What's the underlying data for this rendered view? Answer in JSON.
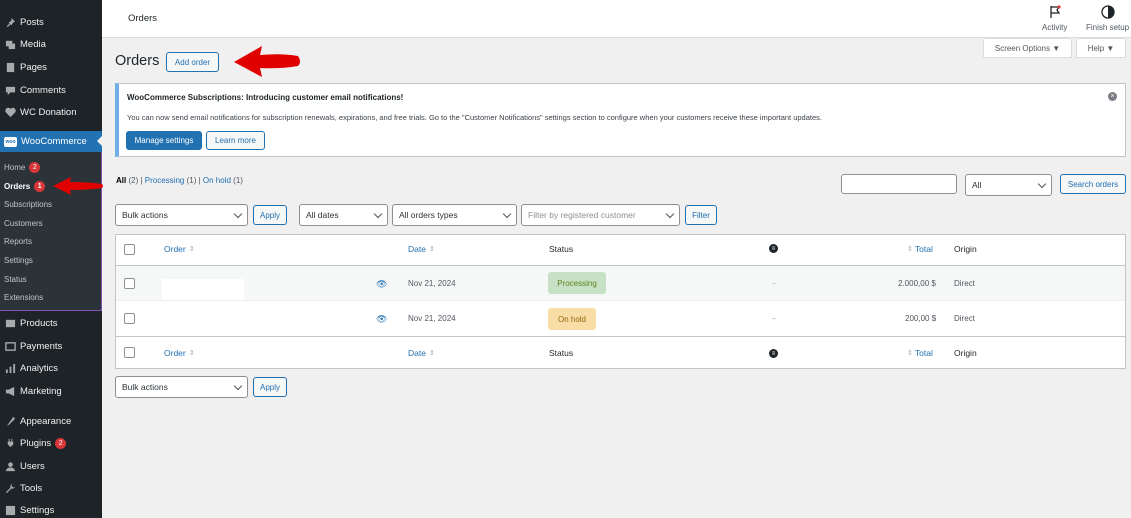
{
  "sidebar": {
    "items": [
      {
        "label": "Posts",
        "icon": "pin-icon"
      },
      {
        "label": "Media",
        "icon": "media-icon"
      },
      {
        "label": "Pages",
        "icon": "pages-icon"
      },
      {
        "label": "Comments",
        "icon": "comments-icon"
      },
      {
        "label": "WC Donation",
        "icon": "heart-icon"
      }
    ],
    "woocommerce": {
      "label": "WooCommerce",
      "logo_text": "woo",
      "submenu": [
        {
          "label": "Home",
          "badge": "2"
        },
        {
          "label": "Orders",
          "badge": "1"
        },
        {
          "label": "Subscriptions"
        },
        {
          "label": "Customers"
        },
        {
          "label": "Reports"
        },
        {
          "label": "Settings"
        },
        {
          "label": "Status"
        },
        {
          "label": "Extensions"
        }
      ]
    },
    "lower_items": [
      {
        "label": "Products",
        "icon": "products-icon"
      },
      {
        "label": "Payments",
        "icon": "payments-icon"
      },
      {
        "label": "Analytics",
        "icon": "analytics-icon"
      },
      {
        "label": "Marketing",
        "icon": "marketing-icon"
      },
      {
        "label": "Appearance",
        "icon": "appearance-icon"
      },
      {
        "label": "Plugins",
        "icon": "plugins-icon",
        "badge": "2"
      },
      {
        "label": "Users",
        "icon": "users-icon"
      },
      {
        "label": "Tools",
        "icon": "tools-icon"
      },
      {
        "label": "Settings",
        "icon": "settings-icon"
      }
    ]
  },
  "topbar": {
    "title": "Orders",
    "activity_label": "Activity",
    "finish_setup_label": "Finish setup"
  },
  "page": {
    "title": "Orders",
    "add_order_label": "Add order",
    "screen_options_label": "Screen Options ▼",
    "help_label": "Help ▼"
  },
  "notice": {
    "title": "WooCommerce Subscriptions: Introducing customer email notifications!",
    "text": "You can now send email notifications for subscription renewals, expirations, and free trials. Go to the \"Customer Notifications\" settings section to configure when your customers receive these important updates.",
    "manage_label": "Manage settings",
    "learn_label": "Learn more"
  },
  "filters": {
    "all_label": "All",
    "all_count": "(2)",
    "processing_label": "Processing",
    "processing_count": "(1)",
    "onhold_label": "On hold",
    "onhold_count": "(1)",
    "status_select": "All",
    "search_button": "Search orders",
    "bulk_actions": "Bulk actions",
    "apply": "Apply",
    "dates": "All dates",
    "order_types": "All orders types",
    "customer_placeholder": "Filter by registered customer",
    "filter_button": "Filter"
  },
  "table": {
    "headers": {
      "order": "Order",
      "date": "Date",
      "status": "Status",
      "total": "Total",
      "origin": "Origin"
    },
    "rows": [
      {
        "date": "Nov 21, 2024",
        "status": "Processing",
        "billing": "–",
        "total": "2.000,00 $",
        "origin": "Direct"
      },
      {
        "date": "Nov 21, 2024",
        "status": "On hold",
        "billing": "–",
        "total": "200,00 $",
        "origin": "Direct"
      }
    ]
  },
  "colors": {
    "sidebar_bg": "#1d2327",
    "accent": "#2271b1",
    "processing_bg": "#c6e1c6",
    "processing_text": "#5b841b",
    "onhold_bg": "#f8dda7",
    "onhold_text": "#94660c",
    "annotation_arrow": "#e00000"
  }
}
